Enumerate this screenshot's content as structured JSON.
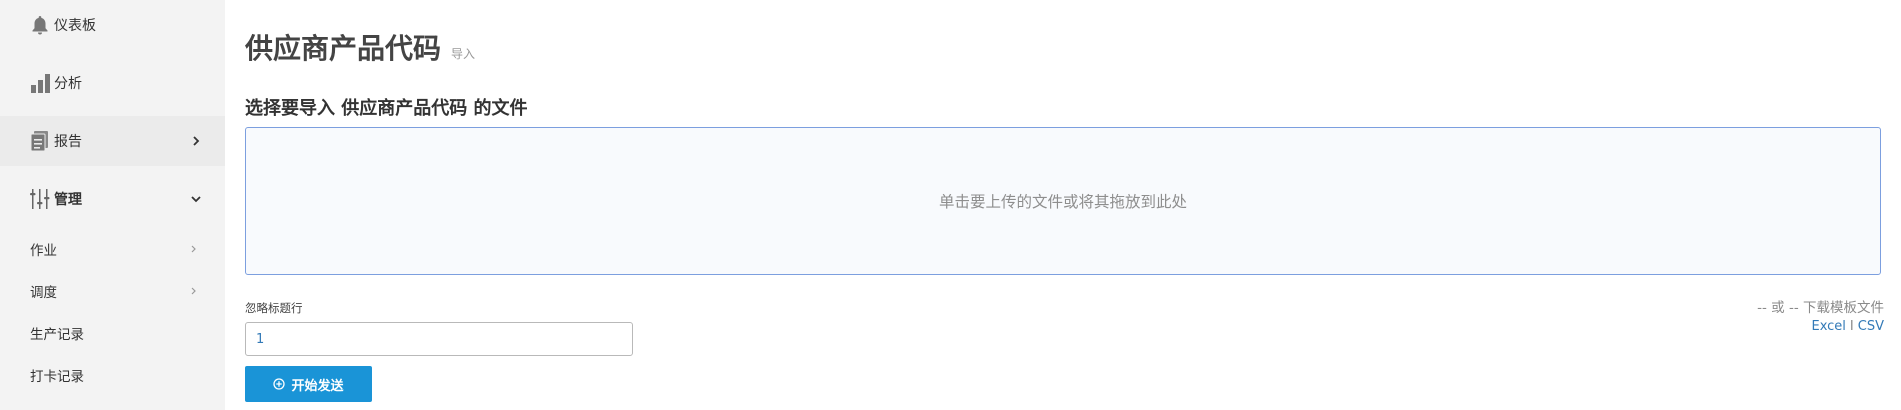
{
  "sidebar": {
    "items": [
      {
        "label": "仪表板",
        "icon": "bell-icon"
      },
      {
        "label": "分析",
        "icon": "bar-chart-icon"
      },
      {
        "label": "报告",
        "icon": "report-icon"
      },
      {
        "label": "管理",
        "icon": "sliders-icon"
      }
    ],
    "sub_items": [
      {
        "label": "作业"
      },
      {
        "label": "调度"
      },
      {
        "label": "生产记录"
      },
      {
        "label": "打卡记录"
      }
    ]
  },
  "main": {
    "title": "供应商产品代码",
    "subtitle": "导入",
    "section_title": "选择要导入 供应商产品代码 的文件",
    "dropzone_text": "单击要上传的文件或将其拖放到此处",
    "ignore_header_label": "忽略标题行",
    "ignore_header_value": "1",
    "start_button": "开始发送",
    "download_text": "-- 或 -- 下载模板文件",
    "excel_link": "Excel",
    "separator": "I",
    "csv_link": "CSV"
  },
  "colors": {
    "sidebar_bg": "#f3f3f3",
    "accent": "#1a94d7",
    "link": "#337ab7",
    "dropzone_border": "#7c9fdf"
  }
}
